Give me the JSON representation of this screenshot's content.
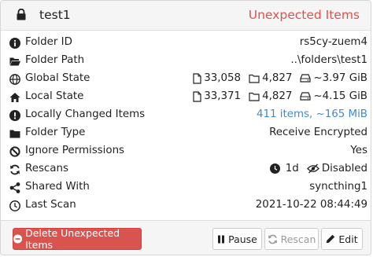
{
  "folder": {
    "name": "test1",
    "status": "Unexpected Items"
  },
  "rows": [
    {
      "icon": "info-circle-icon",
      "label": "Folder ID",
      "value": "rs5cy-zuem4"
    },
    {
      "icon": "folder-open-icon",
      "label": "Folder Path",
      "value": "..\\folders\\test1"
    },
    {
      "icon": "globe-icon",
      "label": "Global State",
      "files": "33,058",
      "dirs": "4,827",
      "size": "~3.97 GiB"
    },
    {
      "icon": "home-icon",
      "label": "Local State",
      "files": "33,371",
      "dirs": "4,827",
      "size": "~4.15 GiB"
    },
    {
      "icon": "exclamation-circle-icon",
      "label": "Locally Changed Items",
      "value": "411 items, ~165 MiB"
    },
    {
      "icon": "folder-icon",
      "label": "Folder Type",
      "value": "Receive Encrypted"
    },
    {
      "icon": "ban-icon",
      "label": "Ignore Permissions",
      "value": "Yes"
    },
    {
      "icon": "refresh-icon",
      "label": "Rescans",
      "interval": "1d",
      "watcher": "Disabled"
    },
    {
      "icon": "share-icon",
      "label": "Shared With",
      "value": "syncthing1"
    },
    {
      "icon": "clock-icon",
      "label": "Last Scan",
      "value": "2021-10-22 08:44:49"
    }
  ],
  "buttons": {
    "delete": "Delete Unexpected Items",
    "pause": "Pause",
    "rescan": "Rescan",
    "edit": "Edit"
  },
  "colors": {
    "danger": "#d9534f",
    "link": "#428bca",
    "header_bg": "#f5f5f5"
  }
}
